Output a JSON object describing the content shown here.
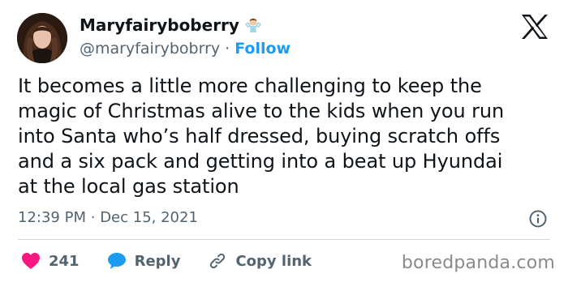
{
  "author": {
    "display_name": "Maryfairyboberry",
    "handle": "@maryfairybobrry",
    "separator": "·",
    "follow_label": "Follow",
    "badge_icon": "fairy-emoji-icon",
    "avatar_icon": "avatar"
  },
  "tweet": {
    "text": "It becomes a little more challenging to keep the\nmagic of Christmas alive to the kids when you run\ninto Santa who’s half dressed, buying scratch offs\nand a six pack and getting into a beat up Hyundai\nat the local gas station",
    "time": "12:39 PM",
    "separator": "·",
    "date": "Dec 15, 2021"
  },
  "actions": {
    "like_count": "241",
    "reply_label": "Reply",
    "copy_link_label": "Copy link"
  },
  "brand": {
    "platform_icon": "x-logo-icon",
    "watermark": "boredpanda.com"
  },
  "colors": {
    "text": "#0f1419",
    "secondary": "#536471",
    "link": "#1d9bf0",
    "like": "#f91880",
    "divider": "#cfd9de"
  }
}
